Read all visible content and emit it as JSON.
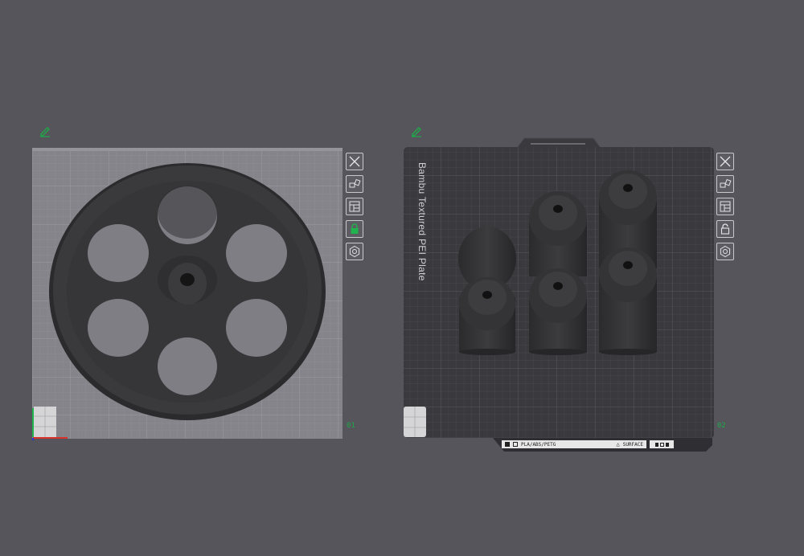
{
  "plates": [
    {
      "number": "01",
      "tools": [
        "close-icon",
        "auto-orient-icon",
        "arrange-icon",
        "lock-icon",
        "settings-icon"
      ],
      "locked": true
    },
    {
      "number": "02",
      "bed_label": "Bambu Textured PEI Plate",
      "nameplate": {
        "left_text": "PLA/ABS/PETG",
        "right_text": "SURFACE"
      },
      "tools": [
        "close-icon",
        "auto-orient-icon",
        "arrange-icon",
        "unlock-icon",
        "settings-icon"
      ],
      "locked": false
    }
  ],
  "colors": {
    "background": "#56555b",
    "plate_light": "#87868b",
    "plate_dark": "#3a393d",
    "accent": "#1fa84a"
  }
}
